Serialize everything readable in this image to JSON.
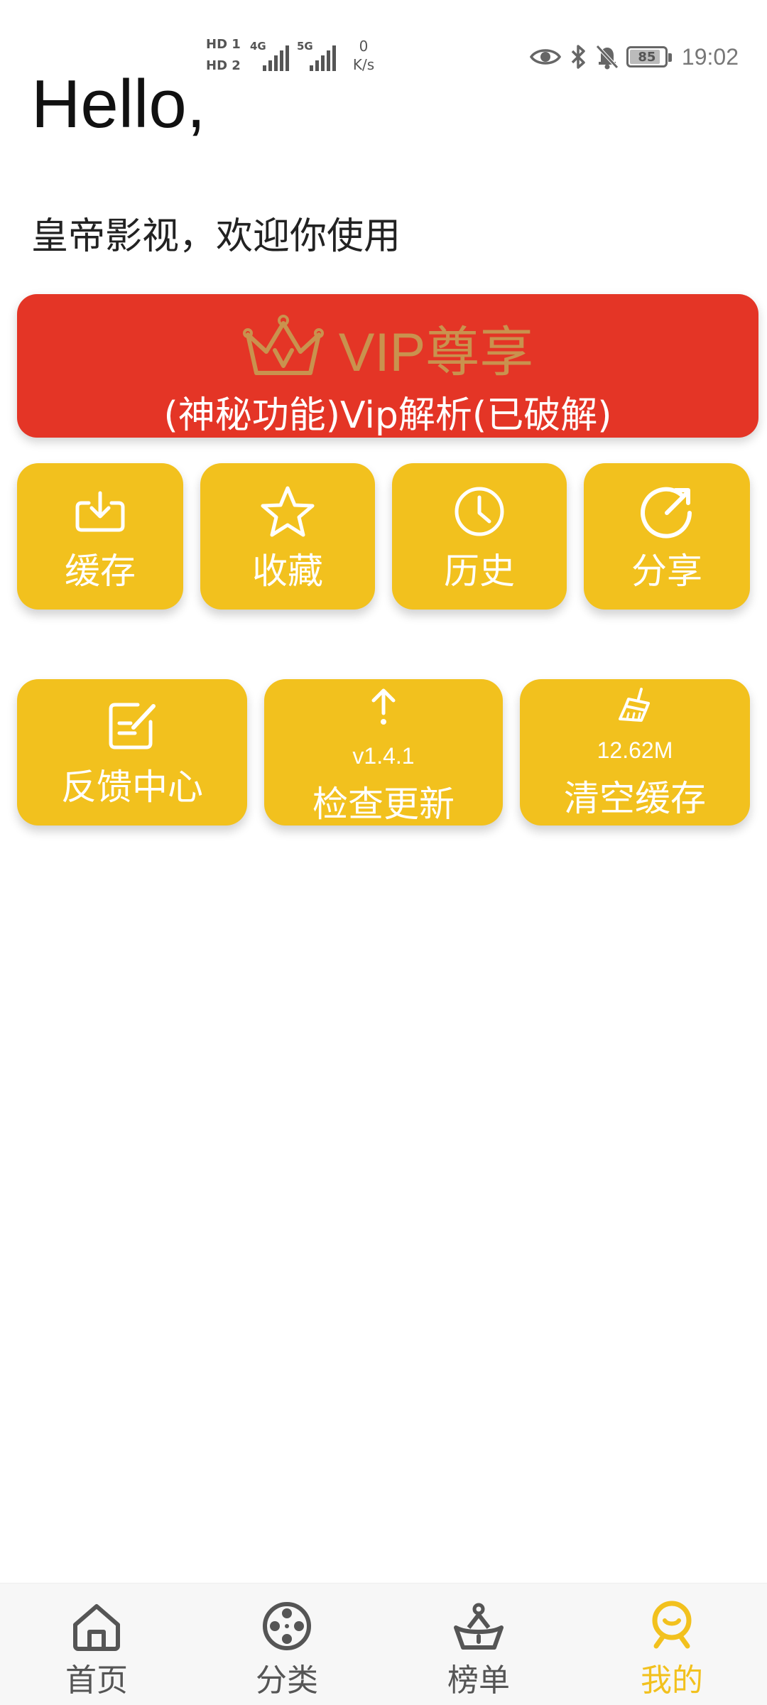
{
  "status_bar": {
    "hd1": "HD 1",
    "hd2": "HD 2",
    "sig1_label": "4G",
    "sig2_label": "5G",
    "speed_value": "0",
    "speed_unit": "K/s",
    "battery": "85",
    "time": "19:02"
  },
  "header": {
    "greeting": "Hello,",
    "welcome": "皇帝影视，欢迎你使用"
  },
  "vip": {
    "title": "VIP尊享",
    "subtitle": "(神秘功能)Vip解析(已破解)",
    "title_color": "#c9924e",
    "bg_color": "#e43526"
  },
  "tiles_row1": [
    {
      "label": "缓存",
      "icon": "download-icon"
    },
    {
      "label": "收藏",
      "icon": "star-icon"
    },
    {
      "label": "历史",
      "icon": "clock-icon"
    },
    {
      "label": "分享",
      "icon": "share-icon"
    }
  ],
  "tiles_row2": [
    {
      "label": "反馈中心",
      "icon": "edit-icon"
    },
    {
      "label": "检查更新",
      "icon": "arrow-up-icon",
      "version": "v1.4.1"
    },
    {
      "label": "清空缓存",
      "icon": "broom-icon",
      "cache_size": "12.62M"
    }
  ],
  "bottom_nav": [
    {
      "label": "首页",
      "icon": "home-icon",
      "active": false
    },
    {
      "label": "分类",
      "icon": "film-reel-icon",
      "active": false
    },
    {
      "label": "榜单",
      "icon": "trophy-icon",
      "active": false
    },
    {
      "label": "我的",
      "icon": "user-icon",
      "active": true
    }
  ],
  "colors": {
    "tile": "#f2c11e",
    "active_nav": "#f2c11e"
  }
}
